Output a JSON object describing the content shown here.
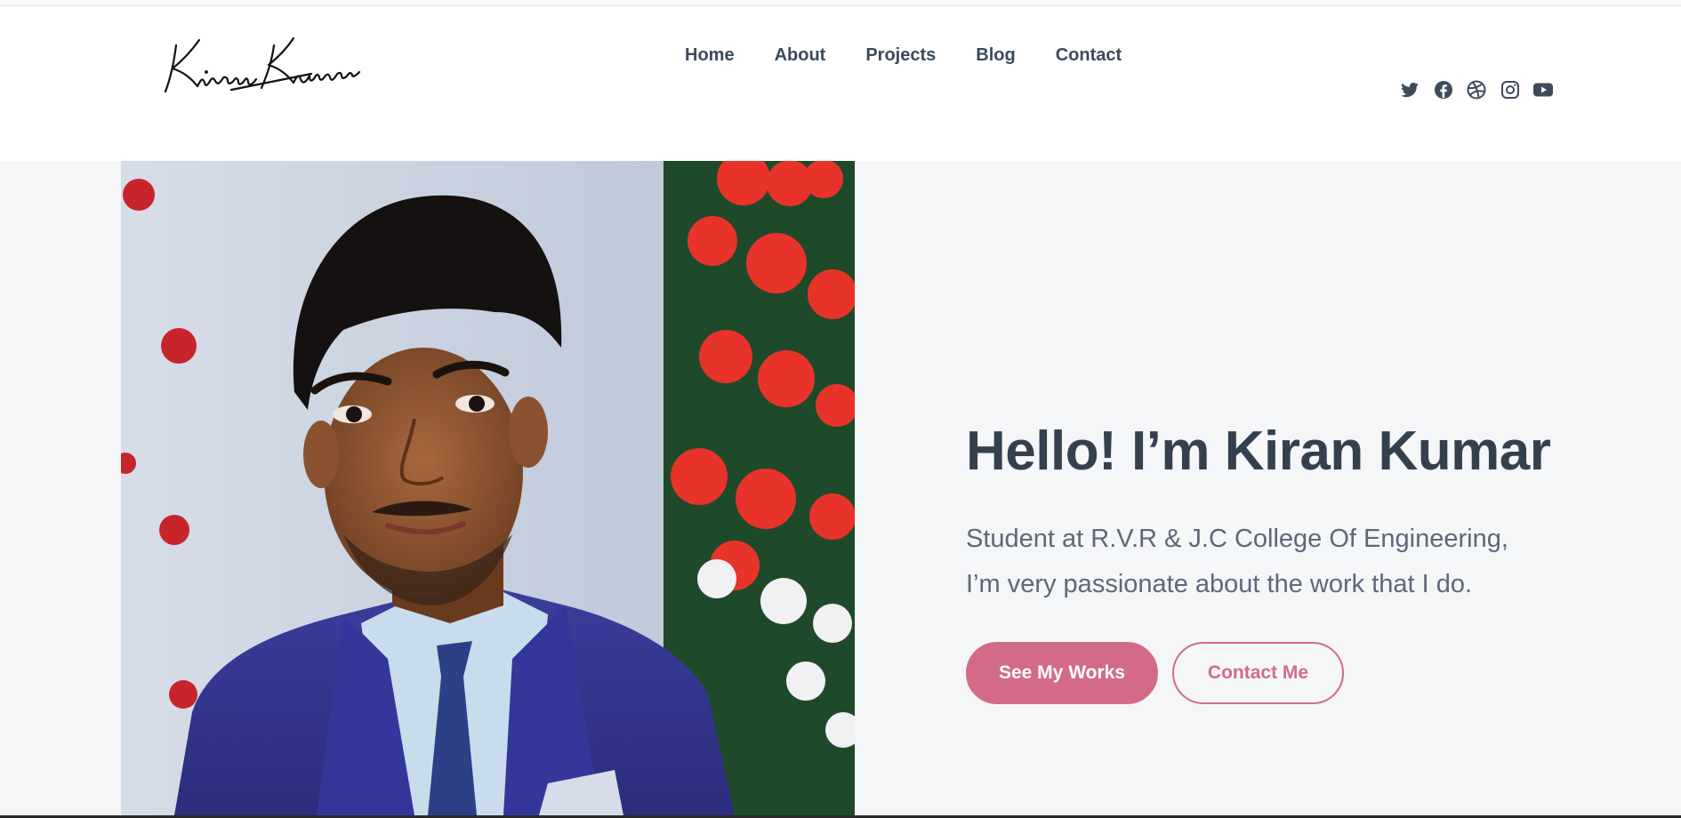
{
  "header": {
    "logo_text": "Kiran Kumar",
    "nav": [
      {
        "label": "Home"
      },
      {
        "label": "About"
      },
      {
        "label": "Projects"
      },
      {
        "label": "Blog"
      },
      {
        "label": "Contact"
      }
    ],
    "socials": [
      {
        "icon": "twitter-icon"
      },
      {
        "icon": "facebook-icon"
      },
      {
        "icon": "dribbble-icon"
      },
      {
        "icon": "instagram-icon"
      },
      {
        "icon": "youtube-icon"
      }
    ]
  },
  "hero": {
    "title": "Hello! I’m Kiran Kumar",
    "subtitle_line1": "Student at R.V.R & J.C College Of Engineering,",
    "subtitle_line2": "I’m very passionate about the work that I do.",
    "primary_button": "See My Works",
    "secondary_button": "Contact Me"
  },
  "colors": {
    "accent": "#d36b88",
    "heading": "#35404f",
    "text": "#5f6878",
    "hero_background": "#f4f6f8",
    "nav_text": "#3d4a5c"
  }
}
